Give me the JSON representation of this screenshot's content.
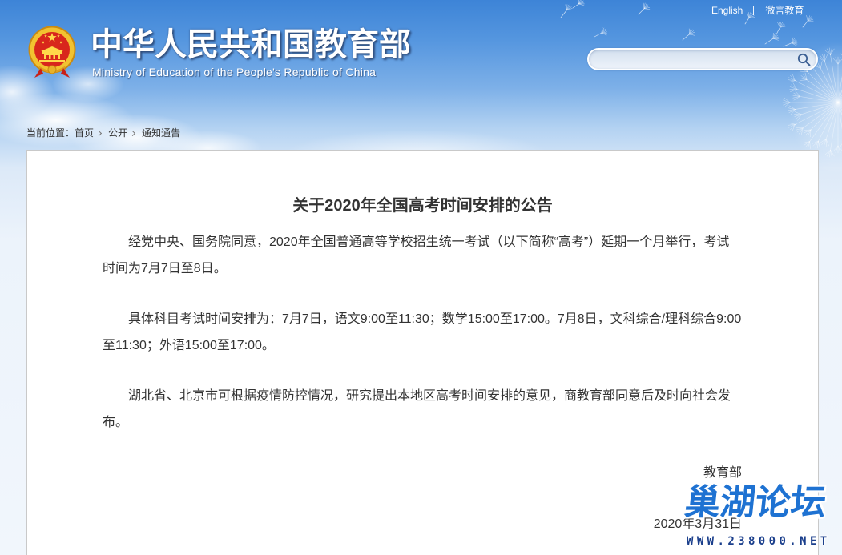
{
  "header": {
    "top_links": [
      "English",
      "微言教育"
    ],
    "site_title": "中华人民共和国教育部",
    "site_subtitle": "Ministry of Education of the People's Republic of China",
    "search": {
      "value": "",
      "placeholder": ""
    }
  },
  "breadcrumb": {
    "label": "当前位置：",
    "items": [
      "首页",
      "公开",
      "通知通告"
    ]
  },
  "article": {
    "title": "关于2020年全国高考时间安排的公告",
    "paragraphs": [
      "经党中央、国务院同意，2020年全国普通高等学校招生统一考试（以下简称“高考”）延期一个月举行，考试时间为7月7日至8日。",
      "具体科目考试时间安排为：7月7日，语文9:00至11:30；数学15:00至17:00。7月8日，文科综合/理科综合9:00至11:30；外语15:00至17:00。",
      "湖北省、北京市可根据疫情防控情况，研究提出本地区高考时间安排的意见，商教育部同意后及时向社会发布。"
    ],
    "signature": "教育部",
    "date": "2020年3月31日"
  },
  "watermark": {
    "name": "巢湖论坛",
    "url": "WWW.238000.NET"
  },
  "icons": {
    "emblem": "national-emblem-icon",
    "search": "search-icon",
    "breadcrumb_separator": "chevron-right-icon",
    "decoration": "dandelion-decoration"
  },
  "colors": {
    "sky_top": "#3d84d7",
    "sky_bottom": "#f1f6fc",
    "header_text": "#ffffff",
    "body_text": "#333333",
    "content_border": "#c9c9c9",
    "emblem_red": "#d8261c",
    "emblem_gold": "#f2c230",
    "watermark_blue": "#1e72d2",
    "watermark_url": "#1b3f8c"
  }
}
